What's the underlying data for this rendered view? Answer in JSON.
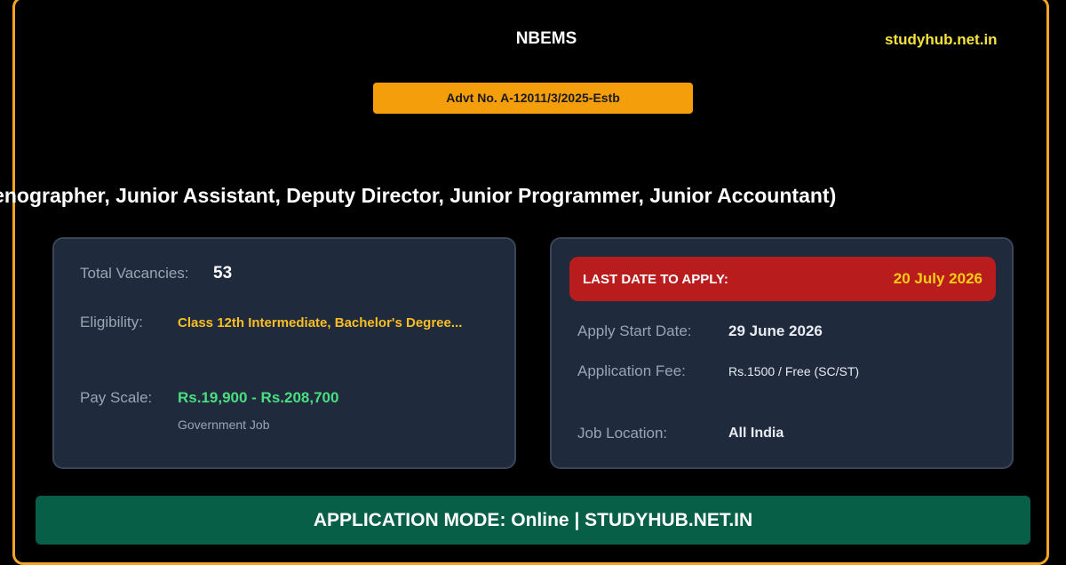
{
  "header": {
    "org": "NBEMS",
    "site": "studyhub.net.in",
    "advt": "Advt No. A-12011/3/2025-Estb"
  },
  "headline": "Group A, B & C Various Posts (Stenographer, Junior Assistant, Deputy Director, Junior Programmer, Junior Accountant)",
  "summary": {
    "vacancies_label": "Total Vacancies:",
    "vacancies_value": "53",
    "eligibility_label": "Eligibility:",
    "eligibility_value": "Class 12th Intermediate, Bachelor's Degree...",
    "pay_label": "Pay Scale:",
    "pay_value": "Rs.19,900 - Rs.208,700",
    "job_type": "Government Job"
  },
  "dates": {
    "last_date_label": "LAST DATE TO APPLY:",
    "last_date_value": "20 July 2026",
    "start_label": "Apply Start Date:",
    "start_value": "29 June 2026",
    "fee_label": "Application Fee:",
    "fee_value": "Rs.1500 / Free (SC/ST)",
    "location_label": "Job Location:",
    "location_value": "All India"
  },
  "footer": {
    "mode": "APPLICATION MODE: Online | STUDYHUB.NET.IN"
  },
  "colors": {
    "accent_orange": "#f59e0b",
    "site_yellow": "#f5e23a",
    "deadline_red": "#b91c1c",
    "pay_green": "#4ade80",
    "eligibility_amber": "#fbbf24",
    "footer_green": "#065f46",
    "card_bg": "#1f2a3d"
  }
}
